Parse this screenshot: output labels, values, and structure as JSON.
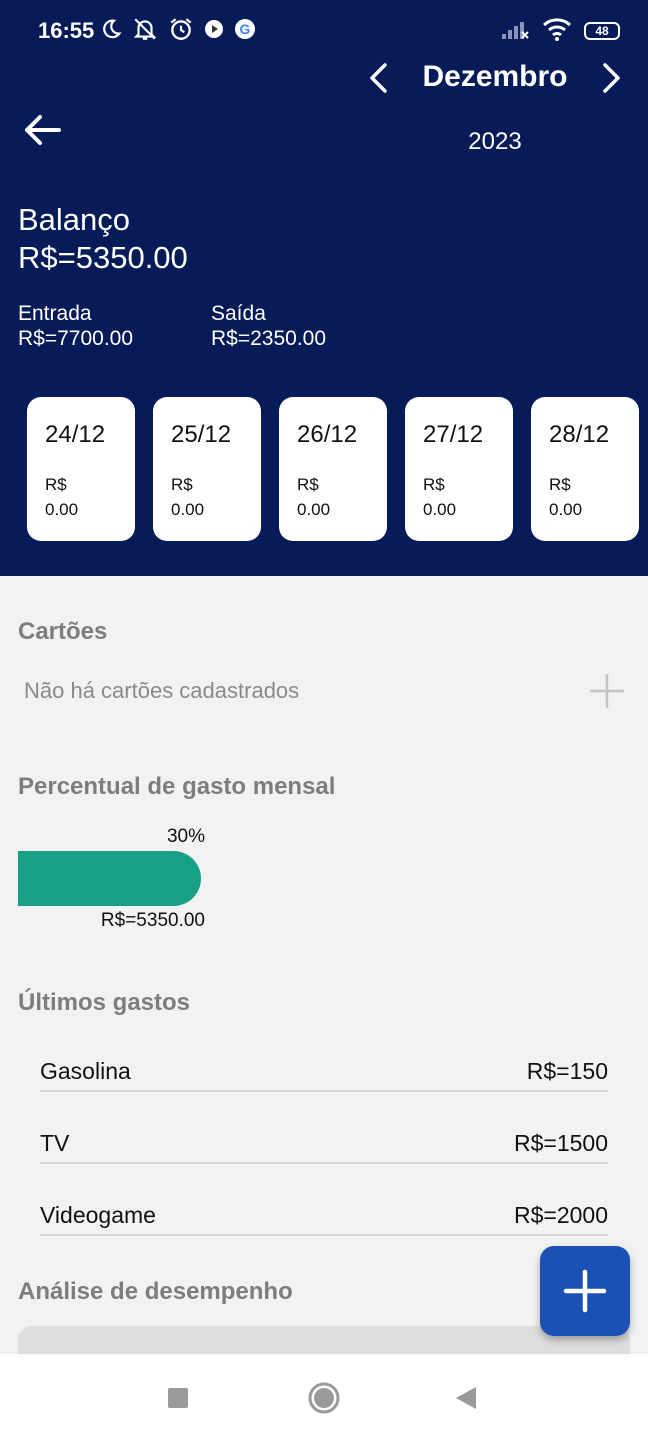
{
  "status_bar": {
    "time": "16:55",
    "battery": "48",
    "icons_left": [
      "moon-icon",
      "bell-off-icon",
      "alarm-icon",
      "location-dot-icon",
      "google-icon"
    ],
    "icons_right": [
      "signal-off-icon",
      "wifi-icon",
      "battery-icon"
    ]
  },
  "header": {
    "month": "Dezembro",
    "year": "2023",
    "balance_label": "Balanço",
    "balance_value": "R$=5350.00",
    "income_label": "Entrada",
    "income_value": "R$=7700.00",
    "expense_label": "Saída",
    "expense_value": "R$=2350.00",
    "background_color": "#061b57"
  },
  "days": [
    {
      "date": "24/12",
      "currency": "R$",
      "value": "0.00"
    },
    {
      "date": "25/12",
      "currency": "R$",
      "value": "0.00"
    },
    {
      "date": "26/12",
      "currency": "R$",
      "value": "0.00"
    },
    {
      "date": "27/12",
      "currency": "R$",
      "value": "0.00"
    },
    {
      "date": "28/12",
      "currency": "R$",
      "value": "0.00"
    }
  ],
  "cards_section": {
    "title": "Cartões",
    "empty_text": "Não há cartões cadastrados"
  },
  "spending_section": {
    "title": "Percentual de gasto mensal",
    "percent_label": "30%",
    "fill_fraction": 0.3,
    "amount": "R$=5350.00",
    "bar_color": "#17a085"
  },
  "recent_section": {
    "title": "Últimos gastos",
    "items": [
      {
        "name": "Gasolina",
        "value": "R$=150"
      },
      {
        "name": "TV",
        "value": "R$=1500"
      },
      {
        "name": "Videogame",
        "value": "R$=2000"
      }
    ]
  },
  "performance_section": {
    "title": "Análise de desempenho"
  },
  "fab_color": "#1b51b5",
  "nav": [
    "recents-square-icon",
    "home-circle-icon",
    "back-triangle-icon"
  ]
}
